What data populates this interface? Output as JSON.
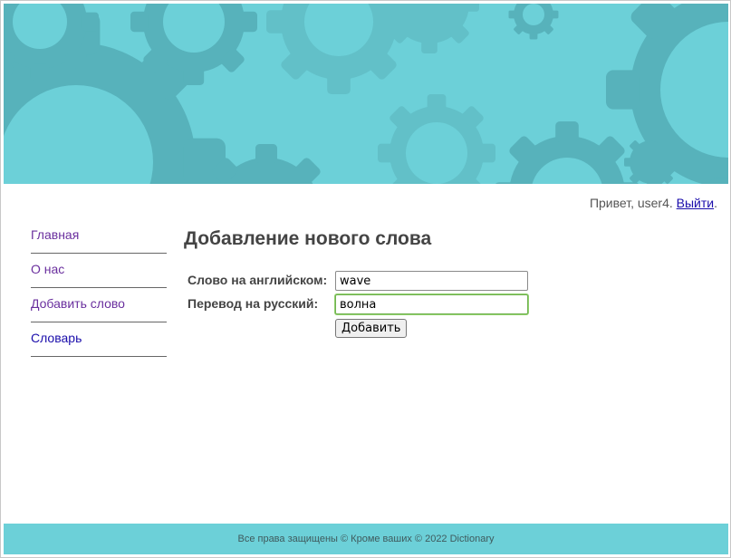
{
  "colors": {
    "header_bg": "#6cd0d8",
    "gear_dark": "#57b2bb",
    "gear_mid": "#62c0c8",
    "gear_light": "#7ad9e0",
    "visited_link": "#6a2f9e",
    "link": "#1a0dab",
    "focus_ring": "#8fd06b"
  },
  "header": {
    "decoration": "gears-banner-icon"
  },
  "user_bar": {
    "greeting": "Привет, user4.",
    "logout_label": "Выйти",
    "trailing": "."
  },
  "sidebar": {
    "items": [
      {
        "label": "Главная",
        "visited": true
      },
      {
        "label": "О нас",
        "visited": true
      },
      {
        "label": "Добавить слово",
        "visited": true
      },
      {
        "label": "Словарь",
        "visited": false
      }
    ]
  },
  "main": {
    "title": "Добавление нового слова",
    "form": {
      "english_label": "Слово на английском:",
      "english_value": "wave",
      "russian_label": "Перевод на русский:",
      "russian_value": "волна",
      "submit_label": "Добавить"
    }
  },
  "footer": {
    "text": "Все права защищены © Кроме ваших © 2022 Dictionary"
  }
}
